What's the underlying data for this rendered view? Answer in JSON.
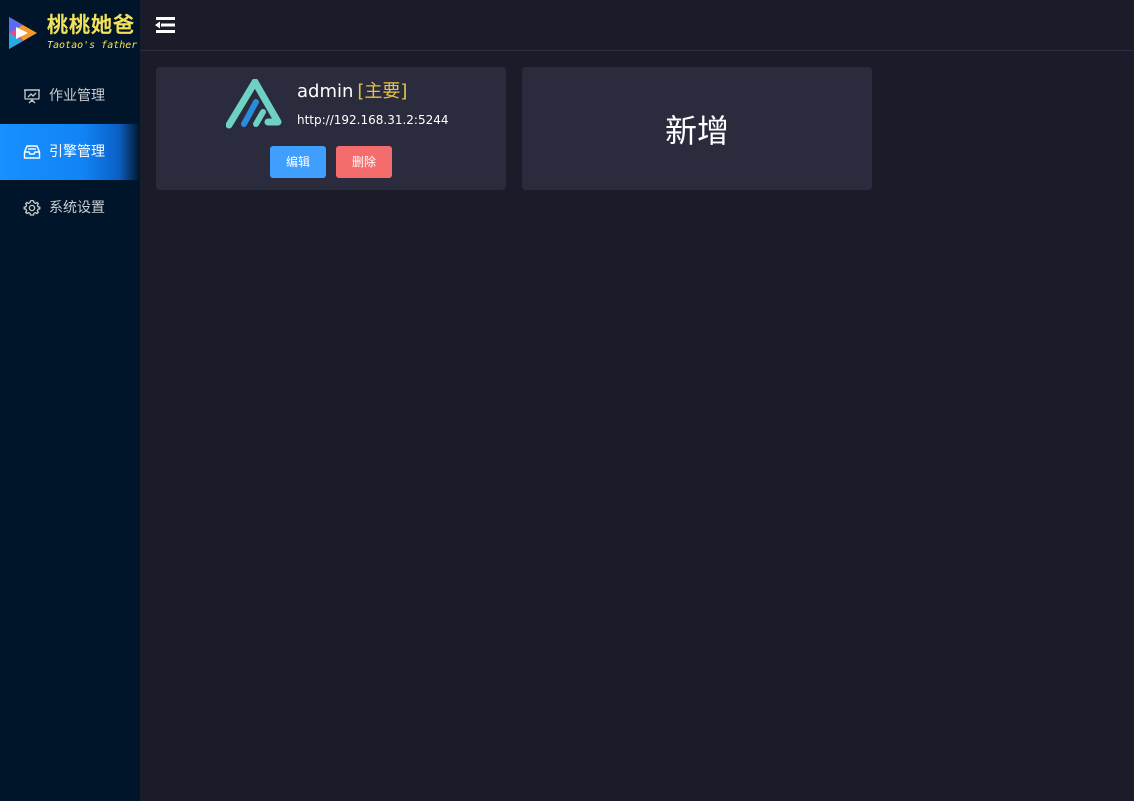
{
  "brand": {
    "title": "桃桃她爸",
    "subtitle": "Taotao's father",
    "logo_icon": "play-logo-icon",
    "color": "#f2e25a"
  },
  "sidebar": {
    "items": [
      {
        "label": "作业管理",
        "icon": "presentation-board-icon",
        "active": false
      },
      {
        "label": "引擎管理",
        "icon": "inbox-tray-icon",
        "active": true
      },
      {
        "label": "系统设置",
        "icon": "gear-icon",
        "active": false
      }
    ],
    "active_color": "#1890ff"
  },
  "header": {
    "menu_toggle_icon": "menu-fold-icon"
  },
  "engines": [
    {
      "name": "admin",
      "tag": "[主要]",
      "url": "http://192.168.31.2:5244",
      "logo_icon": "alist-logo-icon",
      "edit_label": "编辑",
      "delete_label": "删除"
    }
  ],
  "add_card": {
    "label": "新增"
  },
  "colors": {
    "background": "#1b1c29",
    "card": "#2a2b3c",
    "sidebar": "#001529",
    "edit_button": "#409eff",
    "delete_button": "#f56c6c",
    "tag": "#e6c244"
  }
}
